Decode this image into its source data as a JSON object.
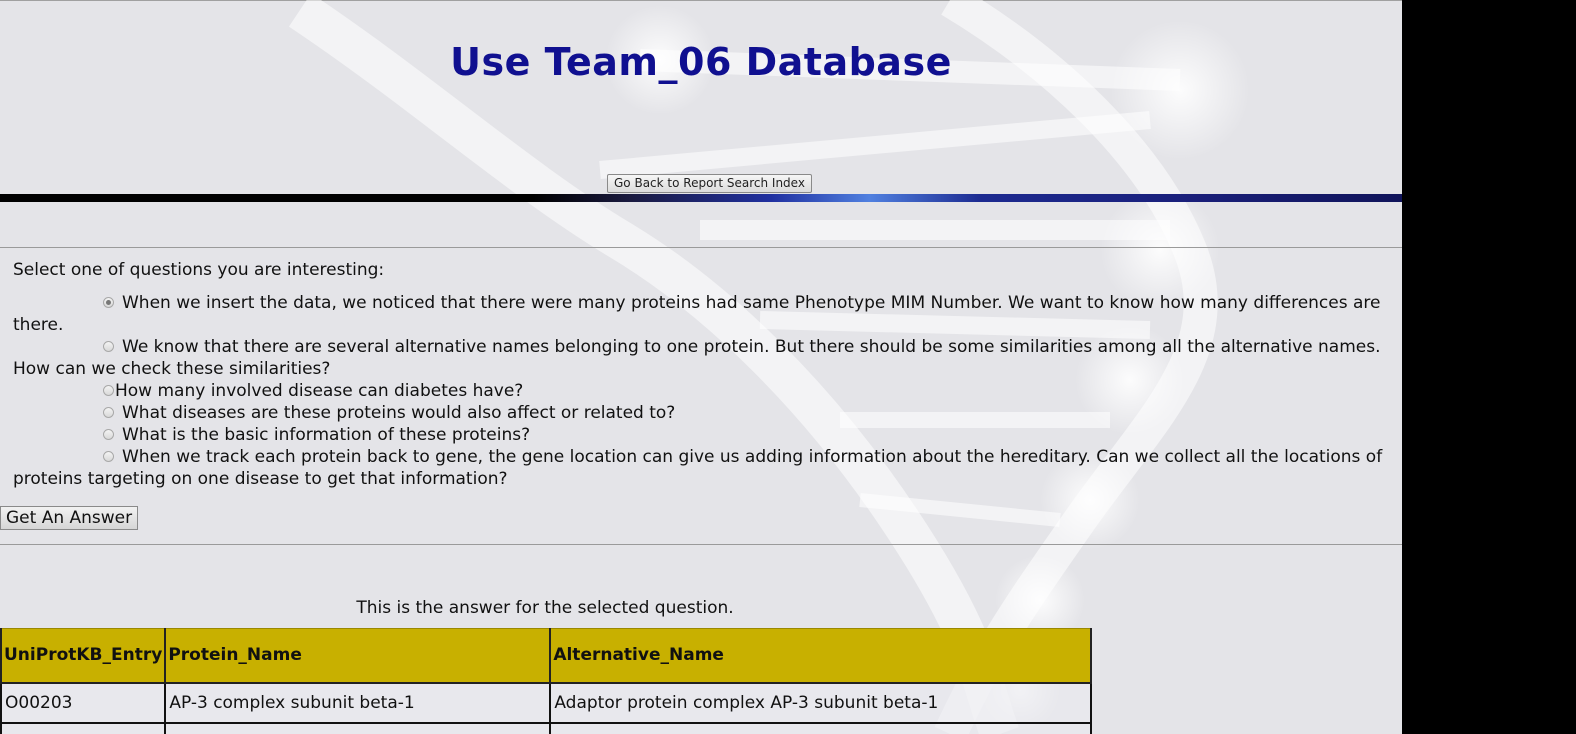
{
  "header": {
    "title": "Use Team_06 Database",
    "back_button_label": "Go Back to Report Search Index"
  },
  "form": {
    "prompt": "Select one of questions you are interesting:",
    "questions": [
      {
        "label": "When we insert the data, we noticed that there were many proteins had same Phenotype MIM Number. We want to know how many differences are there.",
        "checked": true
      },
      {
        "label": "We know that there are several alternative names belonging to one protein. But there should be some similarities among all the alternative names. How can we check these similarities?",
        "checked": false
      },
      {
        "label": "How many involved disease can diabetes have?",
        "checked": false
      },
      {
        "label": "What diseases are these proteins would also affect or related to?",
        "checked": false
      },
      {
        "label": "What is the basic information of these proteins?",
        "checked": false
      },
      {
        "label": "When we track each protein back to gene, the gene location can give us adding information about the hereditary. Can we collect all the locations of proteins targeting on one disease to get that information?",
        "checked": false
      }
    ],
    "submit_label": "Get An Answer"
  },
  "answer": {
    "caption": "This is the answer for the selected question.",
    "columns": [
      "UniProtKB_Entry",
      "Protein_Name",
      "Alternative_Name"
    ],
    "rows": [
      [
        "O00203",
        "AP-3 complex subunit beta-1",
        "Adaptor protein complex AP-3 subunit beta-1"
      ]
    ]
  }
}
